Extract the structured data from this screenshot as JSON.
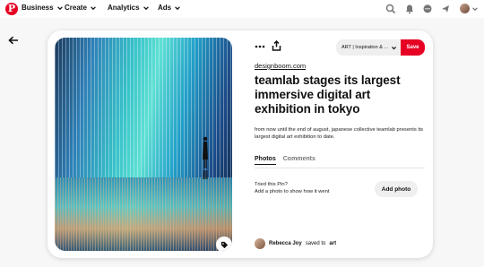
{
  "nav": {
    "logo": "P",
    "items": [
      "Business",
      "Create",
      "Analytics",
      "Ads"
    ]
  },
  "pin": {
    "board_label": "ART | Inspiration & ...",
    "save_label": "Save",
    "source": "designboom.com",
    "title": "teamlab stages its largest immersive digital art exhibition in tokyo",
    "description": "from now until the end of august, japanese collective teamlab presents its largest digital art exhibition to date.",
    "tabs": [
      "Photos",
      "Comments"
    ],
    "tried_title": "Tried this Pin?",
    "tried_sub": "Add a photo to show how it went",
    "add_photo_label": "Add photo",
    "saver_name": "Rebecca Joy",
    "saved_to_text": "saved to",
    "saved_board": "art"
  },
  "colors": {
    "brand": "#e60023",
    "background": "#f7f7f7"
  },
  "icons": [
    "search-icon",
    "bell-icon",
    "chat-icon",
    "bookmark-icon",
    "chevron-down-icon",
    "back-arrow-icon",
    "more-icon",
    "share-icon",
    "tag-icon"
  ]
}
